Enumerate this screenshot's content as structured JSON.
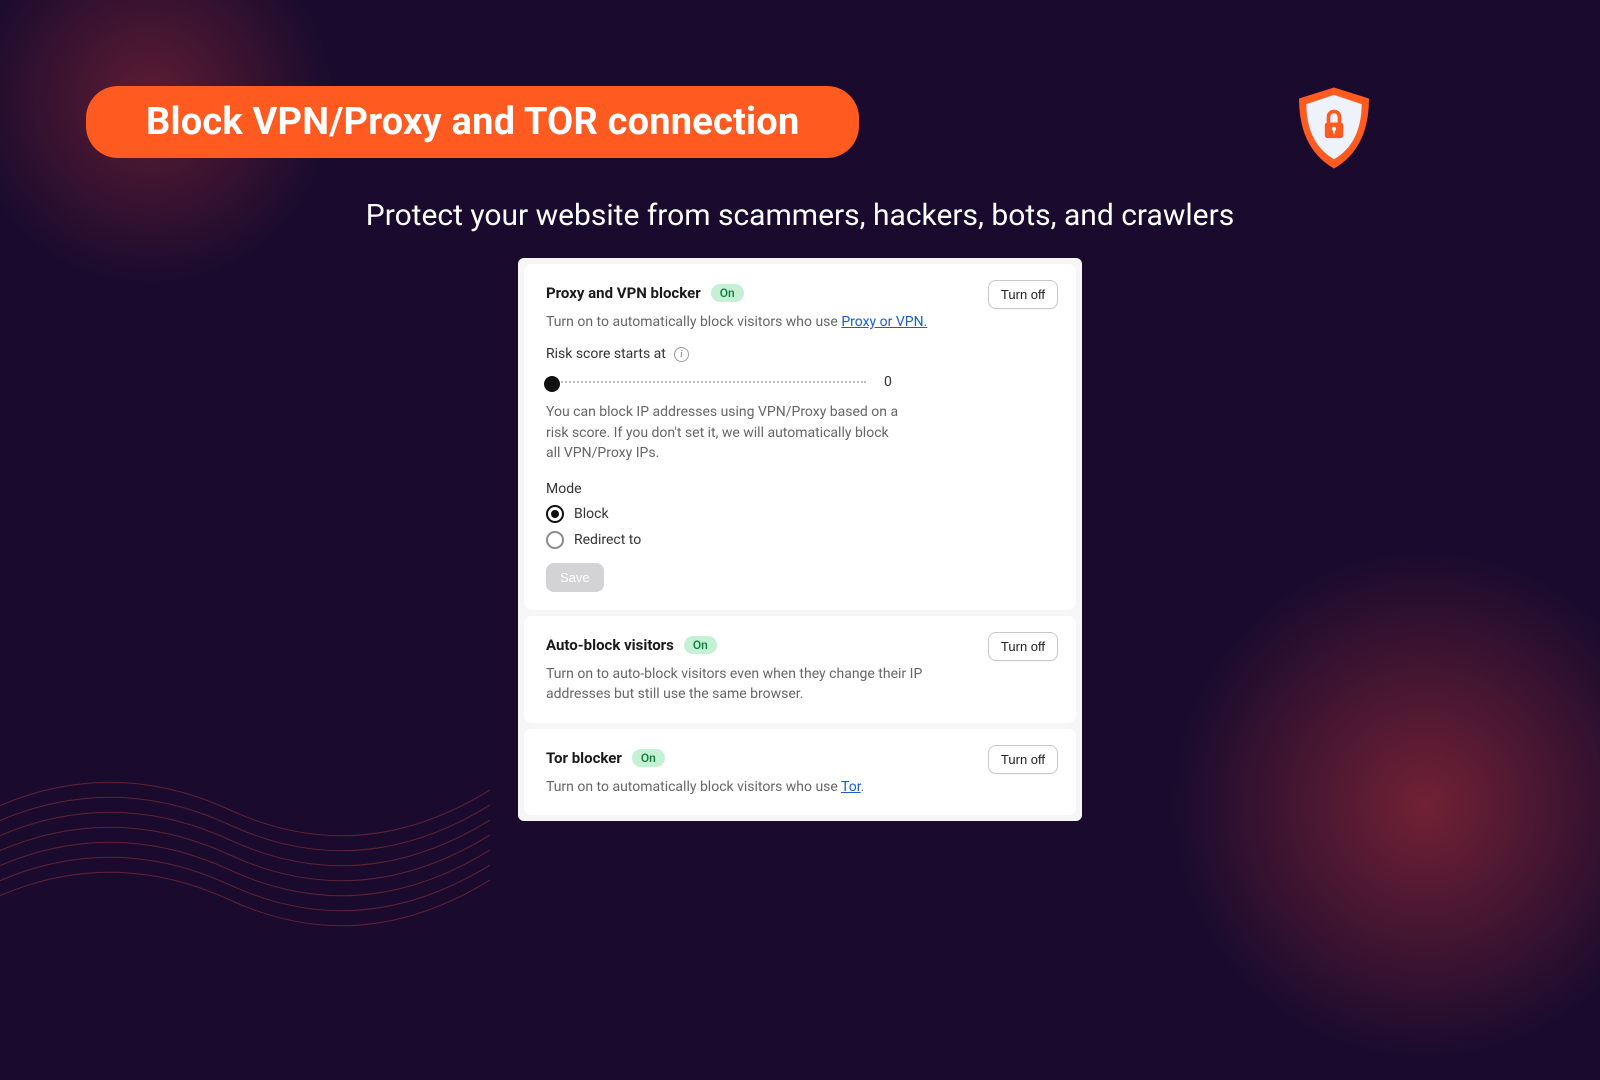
{
  "header": {
    "title": "Block VPN/Proxy and TOR connection",
    "subtitle": "Protect your website from scammers, hackers, bots, and crawlers"
  },
  "buttons": {
    "turn_off": "Turn off",
    "save": "Save"
  },
  "badges": {
    "on": "On"
  },
  "cards": {
    "proxy": {
      "title": "Proxy and VPN blocker",
      "desc_prefix": "Turn on to automatically block visitors who use ",
      "desc_link": "Proxy or VPN.",
      "risk_label": "Risk score starts at",
      "risk_value": "0",
      "helper": "You can block IP addresses using VPN/Proxy based on a risk score. If you don't set it, we will automatically block all VPN/Proxy IPs.",
      "mode_label": "Mode",
      "modes": {
        "block": "Block",
        "redirect": "Redirect to"
      }
    },
    "auto": {
      "title": "Auto-block visitors",
      "desc": "Turn on to auto-block visitors even when they change their IP addresses but still use the same browser."
    },
    "tor": {
      "title": "Tor blocker",
      "desc_prefix": "Turn on to automatically block visitors who use ",
      "desc_link": "Tor",
      "desc_suffix": "."
    }
  }
}
